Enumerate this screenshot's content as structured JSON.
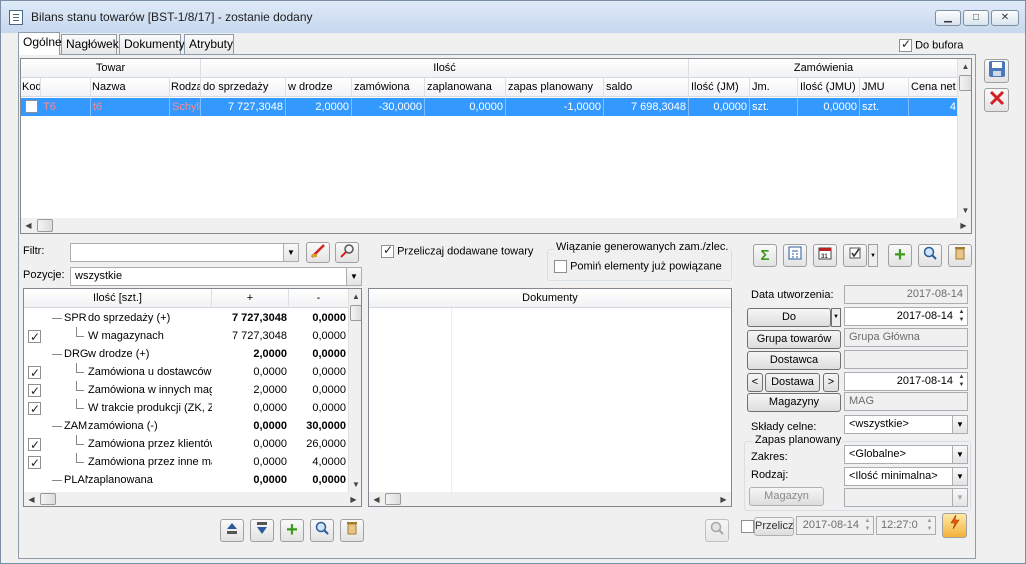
{
  "window": {
    "title": "Bilans stanu towarów [BST-1/8/17] - zostanie dodany",
    "controls": {
      "minimize": "▁",
      "maximize": "□",
      "close": "✕"
    }
  },
  "tabs": [
    {
      "label": "Ogólne",
      "active": true
    },
    {
      "label": "Nagłówek"
    },
    {
      "label": "Dokumenty"
    },
    {
      "label": "Atrybuty"
    }
  ],
  "do_bufora": {
    "label": "Do bufora",
    "checked": true
  },
  "grid": {
    "group_headers": {
      "towar": "Towar",
      "ilosc": "Ilość",
      "zamowienia": "Zamówienia"
    },
    "columns": [
      "Kod",
      "Nazwa",
      "Rodza",
      "do sprzedaży",
      "w drodze",
      "zamówiona",
      "zaplanowana",
      "zapas planowany",
      "saldo",
      "Ilość (JM)",
      "Jm.",
      "Ilość (JMU)",
      "JMU",
      "Cena net"
    ],
    "row": {
      "kod": "T6",
      "nazwa": "t6",
      "rodzaj": "Schylk",
      "do_sprzedazy": "7 727,3048",
      "w_drodze": "2,0000",
      "zamowiona": "-30,0000",
      "zaplanowana": "0,0000",
      "zapas_planowany": "-1,0000",
      "saldo": "7 698,3048",
      "ilosc_jm": "0,0000",
      "jm": "szt.",
      "ilosc_jmu": "0,0000",
      "jmu": "szt.",
      "cena_net": "4"
    }
  },
  "filter": {
    "label": "Filtr:",
    "value": ""
  },
  "pozycje": {
    "label": "Pozycje:",
    "value": "wszystkie"
  },
  "przeliczaj": {
    "label": "Przeliczaj dodawane towary",
    "checked": true
  },
  "wiazanie": {
    "title": "Wiązanie generowanych zam./zlec.",
    "pomin_label": "Pomiń elementy już powiązane",
    "checked": false
  },
  "tree": {
    "headers": {
      "name": "Ilość [szt.]",
      "plus": "+",
      "minus": "-"
    },
    "rows": [
      {
        "code": "SPR",
        "name": "do sprzedaży (+)",
        "plus": "7 727,3048",
        "minus": "0,0000",
        "bold": true,
        "level": 0
      },
      {
        "name": "W magazynach",
        "plus": "7 727,3048",
        "minus": "0,0000",
        "checked": true,
        "level": 1
      },
      {
        "code": "DRG",
        "name": "w drodze (+)",
        "plus": "2,0000",
        "minus": "0,0000",
        "bold": true,
        "level": 0
      },
      {
        "name": "Zamówiona u dostawców (",
        "plus": "0,0000",
        "minus": "0,0000",
        "checked": true,
        "level": 1
      },
      {
        "name": "Zamówiona w innych maga",
        "plus": "2,0000",
        "minus": "0,0000",
        "checked": true,
        "level": 1
      },
      {
        "name": "W trakcie produkcji (ZK, ZL",
        "plus": "0,0000",
        "minus": "0,0000",
        "checked": true,
        "level": 1
      },
      {
        "code": "ZAM",
        "name": "zamówiona (-)",
        "plus": "0,0000",
        "minus": "30,0000",
        "bold": true,
        "level": 0
      },
      {
        "name": "Zamówiona przez klientów",
        "plus": "0,0000",
        "minus": "26,0000",
        "checked": true,
        "level": 1
      },
      {
        "name": "Zamówiona przez inne mag",
        "plus": "0,0000",
        "minus": "4,0000",
        "checked": true,
        "level": 1
      },
      {
        "code": "PLAN",
        "name": "zaplanowana",
        "plus": "0,0000",
        "minus": "0,0000",
        "bold": true,
        "level": 0
      }
    ]
  },
  "dokumenty": {
    "header": "Dokumenty"
  },
  "right_panel": {
    "data_utworzenia_label": "Data utworzenia:",
    "data_utworzenia": "2017-08-14",
    "do_button": "Do",
    "do_date": "2017-08-14",
    "grupa_button": "Grupa towarów",
    "grupa_value": "Grupa Główna",
    "dostawca_button": "Dostawca",
    "dostawca_value": "",
    "prev": "<",
    "dostawa_button": "Dostawa",
    "next": ">",
    "dostawa_date": "2017-08-14",
    "magazyny_button": "Magazyny",
    "magazyny_value": "MAG",
    "sklady_label": "Składy celne:",
    "sklady_value": "<wszystkie>",
    "zapas_title": "Zapas planowany",
    "zakres_label": "Zakres:",
    "zakres_value": "<Globalne>",
    "rodzaj_label": "Rodzaj:",
    "rodzaj_value": "<Ilość minimalna>",
    "magazyn_button": "Magazyn",
    "magazyn_value": "",
    "przelicz_label": "Przelicz",
    "przelicz_date": "2017-08-14",
    "przelicz_time": "12:27:0"
  },
  "toolbar_icons": {
    "sigma": "Σ",
    "plus": "+",
    "search": "⌕"
  },
  "colors": {
    "selection": "#3399ff",
    "pink_text": "#ff8a8a",
    "green": "#3c9a1c",
    "red": "#d42020"
  }
}
